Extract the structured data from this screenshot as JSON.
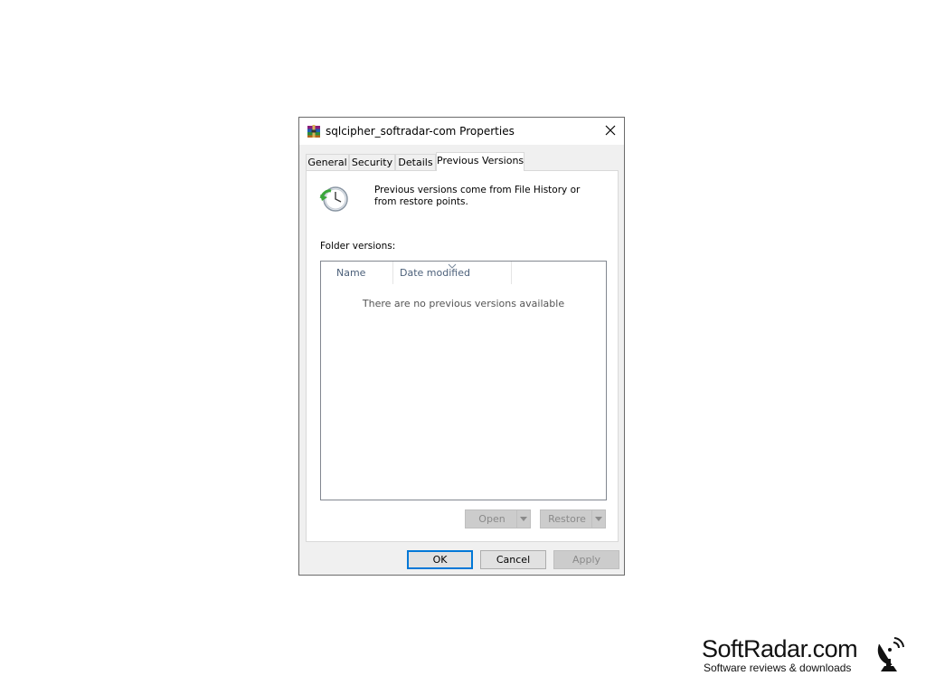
{
  "window": {
    "title": "sqlcipher_softradar-com Properties",
    "close_icon": "close-icon",
    "app_icon": "winrar-archive-icon"
  },
  "tabs": [
    {
      "label": "General",
      "active": false
    },
    {
      "label": "Security",
      "active": false
    },
    {
      "label": "Details",
      "active": false
    },
    {
      "label": "Previous Versions",
      "active": true
    }
  ],
  "previous_versions": {
    "icon": "restore-clock-icon",
    "info_text": "Previous versions come from File History or from restore points.",
    "folder_versions_label": "Folder versions:",
    "columns": [
      "Name",
      "Date modified"
    ],
    "empty_message": "There are no previous versions available",
    "open_button": "Open",
    "restore_button": "Restore"
  },
  "footer": {
    "ok": "OK",
    "cancel": "Cancel",
    "apply": "Apply"
  },
  "watermark": {
    "title": "SoftRadar.com",
    "subtitle": "Software reviews & downloads"
  },
  "colors": {
    "accent": "#0078d7",
    "header_text": "#4c607a",
    "dialog_bg": "#f0f0f0"
  }
}
